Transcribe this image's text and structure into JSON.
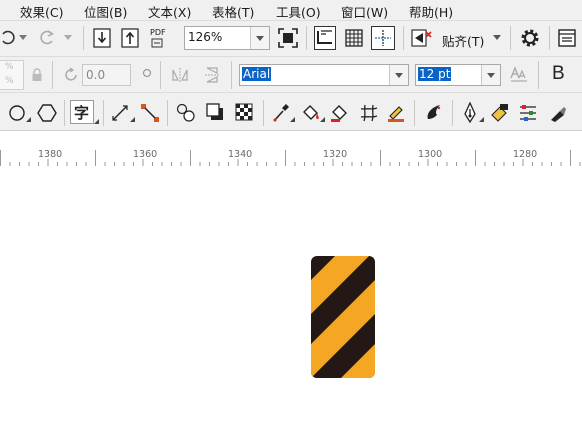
{
  "menu": [
    {
      "label": "效果(C)"
    },
    {
      "label": "位图(B)"
    },
    {
      "label": "文本(X)"
    },
    {
      "label": "表格(T)"
    },
    {
      "label": "工具(O)"
    },
    {
      "label": "窗口(W)"
    },
    {
      "label": "帮助(H)"
    }
  ],
  "toolbar": {
    "pdf_label": "PDF",
    "zoom_value": "126%",
    "snap_label": "贴齐(T)"
  },
  "property_bar": {
    "rotation_value": "0.0",
    "font_name": "Arial",
    "font_size": "12 pt",
    "bold_label": "B"
  },
  "tools": {
    "text_tool_glyph": "字"
  },
  "ruler": {
    "labels": [
      "1380",
      "1360",
      "1340",
      "1320",
      "1300",
      "1280"
    ]
  },
  "canvas": {
    "sign": {
      "stripe_color": "#f5a623",
      "dark_color": "#231815"
    }
  }
}
